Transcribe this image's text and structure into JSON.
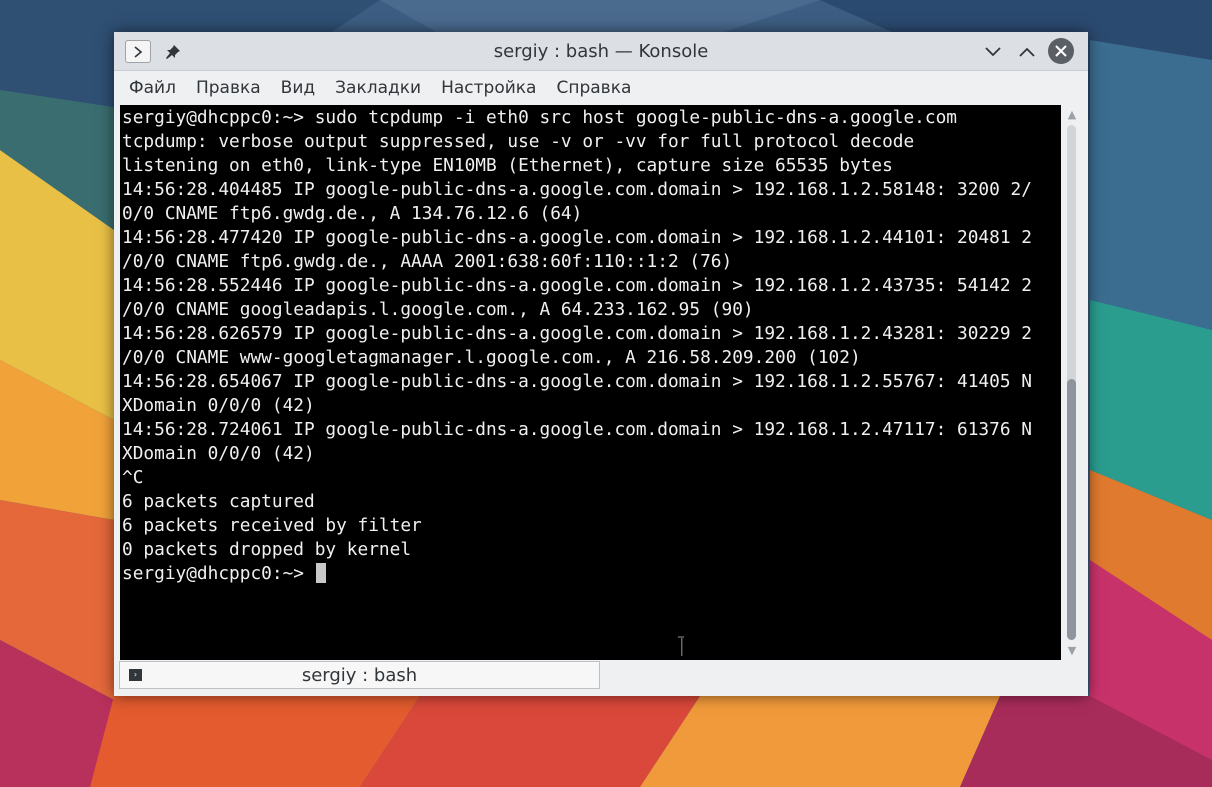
{
  "window": {
    "title": "sergiy : bash — Konsole",
    "menu_icon": "chevron-right-icon",
    "pin_icon": "pin-icon",
    "minimize_icon": "chevron-down-icon",
    "maximize_icon": "chevron-up-icon",
    "close_icon": "close-icon"
  },
  "menubar": {
    "items": [
      "Файл",
      "Правка",
      "Вид",
      "Закладки",
      "Настройка",
      "Справка"
    ]
  },
  "terminal": {
    "lines": [
      "sergiy@dhcppc0:~> sudo tcpdump -i eth0 src host google-public-dns-a.google.com",
      "tcpdump: verbose output suppressed, use -v or -vv for full protocol decode",
      "listening on eth0, link-type EN10MB (Ethernet), capture size 65535 bytes",
      "14:56:28.404485 IP google-public-dns-a.google.com.domain > 192.168.1.2.58148: 3200 2/",
      "0/0 CNAME ftp6.gwdg.de., A 134.76.12.6 (64)",
      "14:56:28.477420 IP google-public-dns-a.google.com.domain > 192.168.1.2.44101: 20481 2",
      "/0/0 CNAME ftp6.gwdg.de., AAAA 2001:638:60f:110::1:2 (76)",
      "14:56:28.552446 IP google-public-dns-a.google.com.domain > 192.168.1.2.43735: 54142 2",
      "/0/0 CNAME googleadapis.l.google.com., A 64.233.162.95 (90)",
      "14:56:28.626579 IP google-public-dns-a.google.com.domain > 192.168.1.2.43281: 30229 2",
      "/0/0 CNAME www-googletagmanager.l.google.com., A 216.58.209.200 (102)",
      "14:56:28.654067 IP google-public-dns-a.google.com.domain > 192.168.1.2.55767: 41405 N",
      "XDomain 0/0/0 (42)",
      "14:56:28.724061 IP google-public-dns-a.google.com.domain > 192.168.1.2.47117: 61376 N",
      "XDomain 0/0/0 (42)",
      "^C",
      "6 packets captured",
      "6 packets received by filter",
      "0 packets dropped by kernel"
    ],
    "prompt": "sergiy@dhcppc0:~> ",
    "scroll_position_fraction": 0.51
  },
  "tabbar": {
    "tab_label": "sergiy : bash",
    "tab_icon": "terminal-icon"
  },
  "colors": {
    "terminal_bg": "#000000",
    "terminal_fg": "#f0f0f0",
    "chrome_bg": "#eff0f1"
  }
}
